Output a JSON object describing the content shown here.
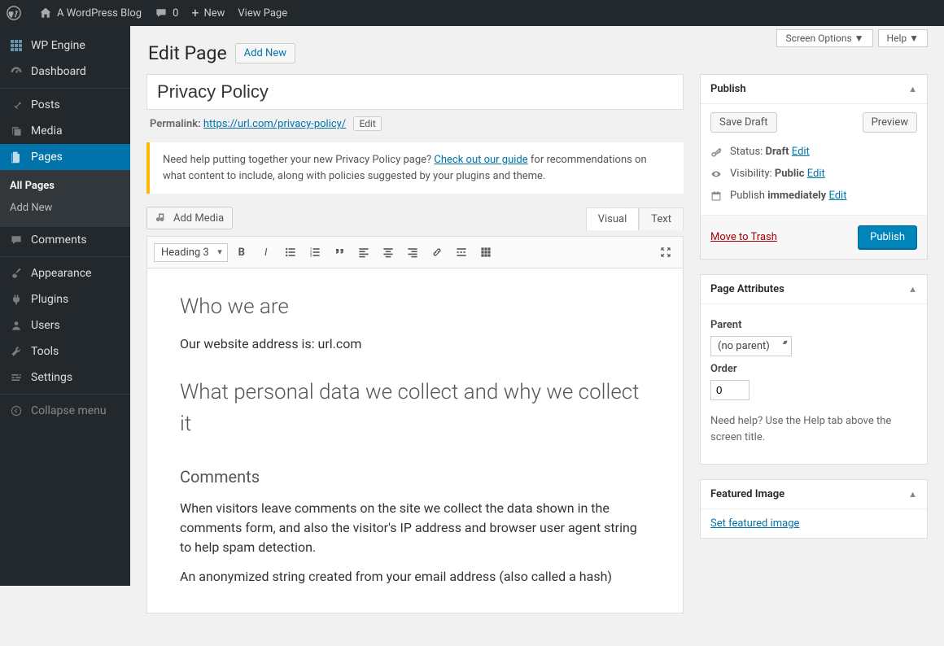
{
  "adminbar": {
    "site_name": "A WordPress Blog",
    "comments_count": "0",
    "new_label": "New",
    "view_page_label": "View Page"
  },
  "sidebar": {
    "items": [
      {
        "label": "WP Engine",
        "icon": "wpengine-icon"
      },
      {
        "label": "Dashboard",
        "icon": "dashboard-icon"
      },
      {
        "label": "Posts",
        "icon": "pin-icon"
      },
      {
        "label": "Media",
        "icon": "media-icon"
      },
      {
        "label": "Pages",
        "icon": "page-icon",
        "current": true,
        "submenu": [
          "All Pages",
          "Add New"
        ]
      },
      {
        "label": "Comments",
        "icon": "comment-icon"
      },
      {
        "label": "Appearance",
        "icon": "brush-icon"
      },
      {
        "label": "Plugins",
        "icon": "plug-icon"
      },
      {
        "label": "Users",
        "icon": "user-icon"
      },
      {
        "label": "Tools",
        "icon": "wrench-icon"
      },
      {
        "label": "Settings",
        "icon": "settings-icon"
      },
      {
        "label": "Collapse menu",
        "icon": "collapse-icon"
      }
    ]
  },
  "top_controls": {
    "screen_options": "Screen Options",
    "help": "Help"
  },
  "header": {
    "title": "Edit Page",
    "add_new": "Add New"
  },
  "title_field": {
    "value": "Privacy Policy"
  },
  "permalink": {
    "label": "Permalink:",
    "url_display": "https://url.com/privacy-policy/",
    "edit": "Edit"
  },
  "notice": {
    "lead": "Need help putting together your new Privacy Policy page? ",
    "link": "Check out our guide",
    "tail": " for recommendations on what content to include, along with policies suggested by your plugins and theme."
  },
  "media_button": "Add Media",
  "editor": {
    "tabs": {
      "visual": "Visual",
      "text": "Text"
    },
    "heading_select": "Heading 3",
    "content": {
      "h2a": "Who we are",
      "p1": "Our website address is: url.com",
      "h2b": "What personal data we collect and why we collect it",
      "h3a": "Comments",
      "p2": "When visitors leave comments on the site we collect the data shown in the comments form, and also the visitor's IP address and browser user agent string to help spam detection.",
      "p3": "An anonymized string created from your email address (also called a hash)"
    }
  },
  "publish": {
    "heading": "Publish",
    "save_draft": "Save Draft",
    "preview": "Preview",
    "status_label": "Status: ",
    "status_value": "Draft",
    "visibility_label": "Visibility: ",
    "visibility_value": "Public",
    "publish_label": "Publish ",
    "publish_value": "immediately",
    "edit": "Edit",
    "trash": "Move to Trash",
    "publish_btn": "Publish"
  },
  "attributes": {
    "heading": "Page Attributes",
    "parent_label": "Parent",
    "parent_value": "(no parent)",
    "order_label": "Order",
    "order_value": "0",
    "help_text": "Need help? Use the Help tab above the screen title."
  },
  "featured": {
    "heading": "Featured Image",
    "link": "Set featured image"
  }
}
